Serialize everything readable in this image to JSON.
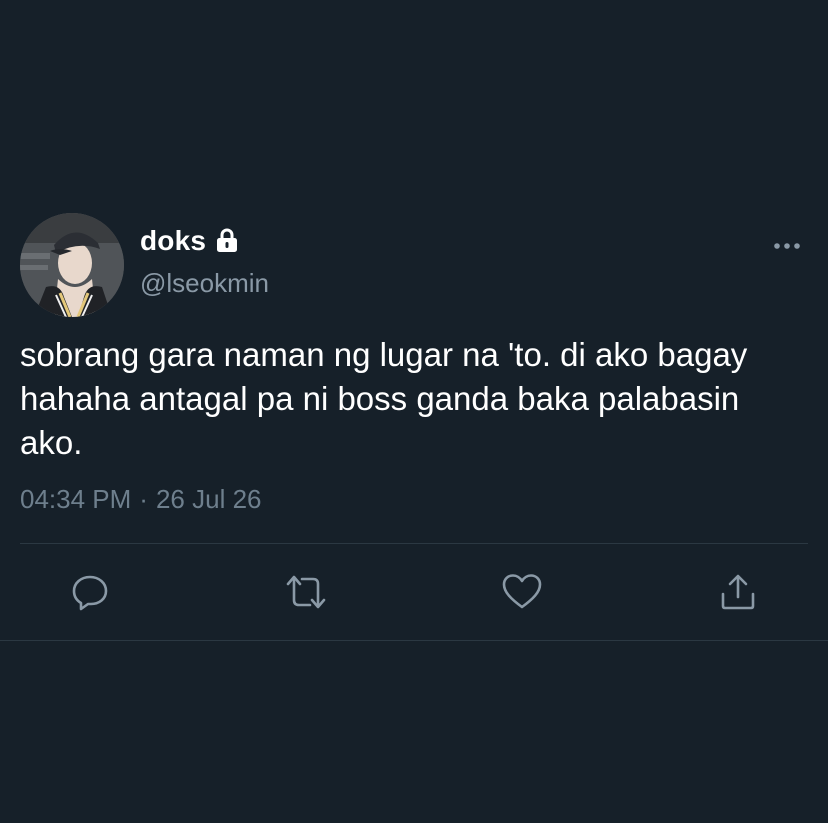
{
  "tweet": {
    "author": {
      "display_name": "doks",
      "handle": "@lseokmin",
      "protected_icon": "lock-icon",
      "avatar": "profile-photo"
    },
    "text": "sobrang gara naman ng lugar na 'to. di ako bagay hahaha antagal pa ni boss ganda baka palabasin ako.",
    "time": "04:34 PM",
    "separator": "·",
    "date": "26 Jul 26",
    "more_icon": "more-horizontal-icon"
  },
  "actions": [
    {
      "name": "reply",
      "icon": "reply-icon"
    },
    {
      "name": "retweet",
      "icon": "retweet-icon"
    },
    {
      "name": "like",
      "icon": "heart-icon"
    },
    {
      "name": "share",
      "icon": "share-icon"
    }
  ],
  "colors": {
    "background": "#162029",
    "primary_text": "#ffffff",
    "secondary_text": "#8a99a6",
    "icon": "#8a99a6",
    "divider": "#2b3842"
  }
}
